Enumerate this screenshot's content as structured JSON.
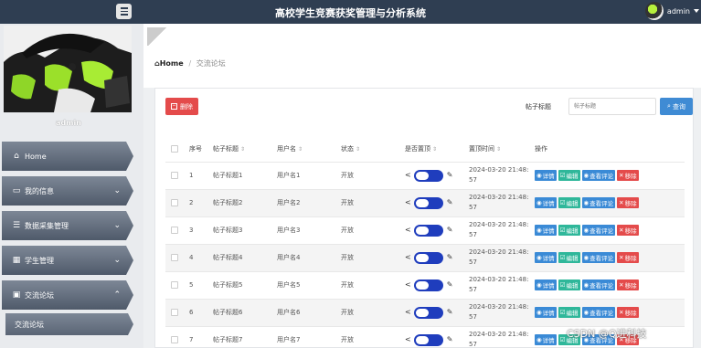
{
  "header": {
    "title": "高校学生竞赛获奖管理与分析系统",
    "user": "admin"
  },
  "sidebar": {
    "profile_name": "admin",
    "items": [
      {
        "label": "Home",
        "icon": "home-icon"
      },
      {
        "label": "我的信息",
        "icon": "id-card-icon"
      },
      {
        "label": "数据采集管理",
        "icon": "sliders-icon"
      },
      {
        "label": "学生管理",
        "icon": "grid-icon"
      },
      {
        "label": "交流论坛",
        "icon": "briefcase-icon"
      }
    ],
    "sub_item": "交流论坛"
  },
  "breadcrumb": {
    "home": "Home",
    "current": "交流论坛"
  },
  "toolbar": {
    "delete_label": "删除",
    "search_label": "帖子标题",
    "search_placeholder": "帖子标题",
    "search_button": "查询"
  },
  "table": {
    "headers": [
      "序号",
      "帖子标题",
      "用户名",
      "状态",
      "是否置顶",
      "置顶时间",
      "操作"
    ],
    "rows": [
      {
        "idx": "1",
        "title": "帖子标题1",
        "user": "用户名1",
        "status": "开放",
        "time_line1": "2024-03-20 21:48:",
        "time_line2": "57"
      },
      {
        "idx": "2",
        "title": "帖子标题2",
        "user": "用户名2",
        "status": "开放",
        "time_line1": "2024-03-20 21:48:",
        "time_line2": "57"
      },
      {
        "idx": "3",
        "title": "帖子标题3",
        "user": "用户名3",
        "status": "开放",
        "time_line1": "2024-03-20 21:48:",
        "time_line2": "57"
      },
      {
        "idx": "4",
        "title": "帖子标题4",
        "user": "用户名4",
        "status": "开放",
        "time_line1": "2024-03-20 21:48:",
        "time_line2": "57"
      },
      {
        "idx": "5",
        "title": "帖子标题5",
        "user": "用户名5",
        "status": "开放",
        "time_line1": "2024-03-20 21:48:",
        "time_line2": "57"
      },
      {
        "idx": "6",
        "title": "帖子标题6",
        "user": "用户名6",
        "status": "开放",
        "time_line1": "2024-03-20 21:48:",
        "time_line2": "57"
      },
      {
        "idx": "7",
        "title": "帖子标题7",
        "user": "用户名7",
        "status": "开放",
        "time_line1": "2024-03-20 21:48:",
        "time_line2": "57"
      }
    ],
    "actions": {
      "detail": "详情",
      "edit": "编辑",
      "comments": "查看评论",
      "remove": "移除"
    }
  },
  "watermark": "CSDN @Q进科技",
  "colors": {
    "topbar": "#2f3e52",
    "primary": "#3a8ad6",
    "danger": "#e44b4b",
    "success": "#2fb79a",
    "toggle": "#1f3dbd"
  }
}
